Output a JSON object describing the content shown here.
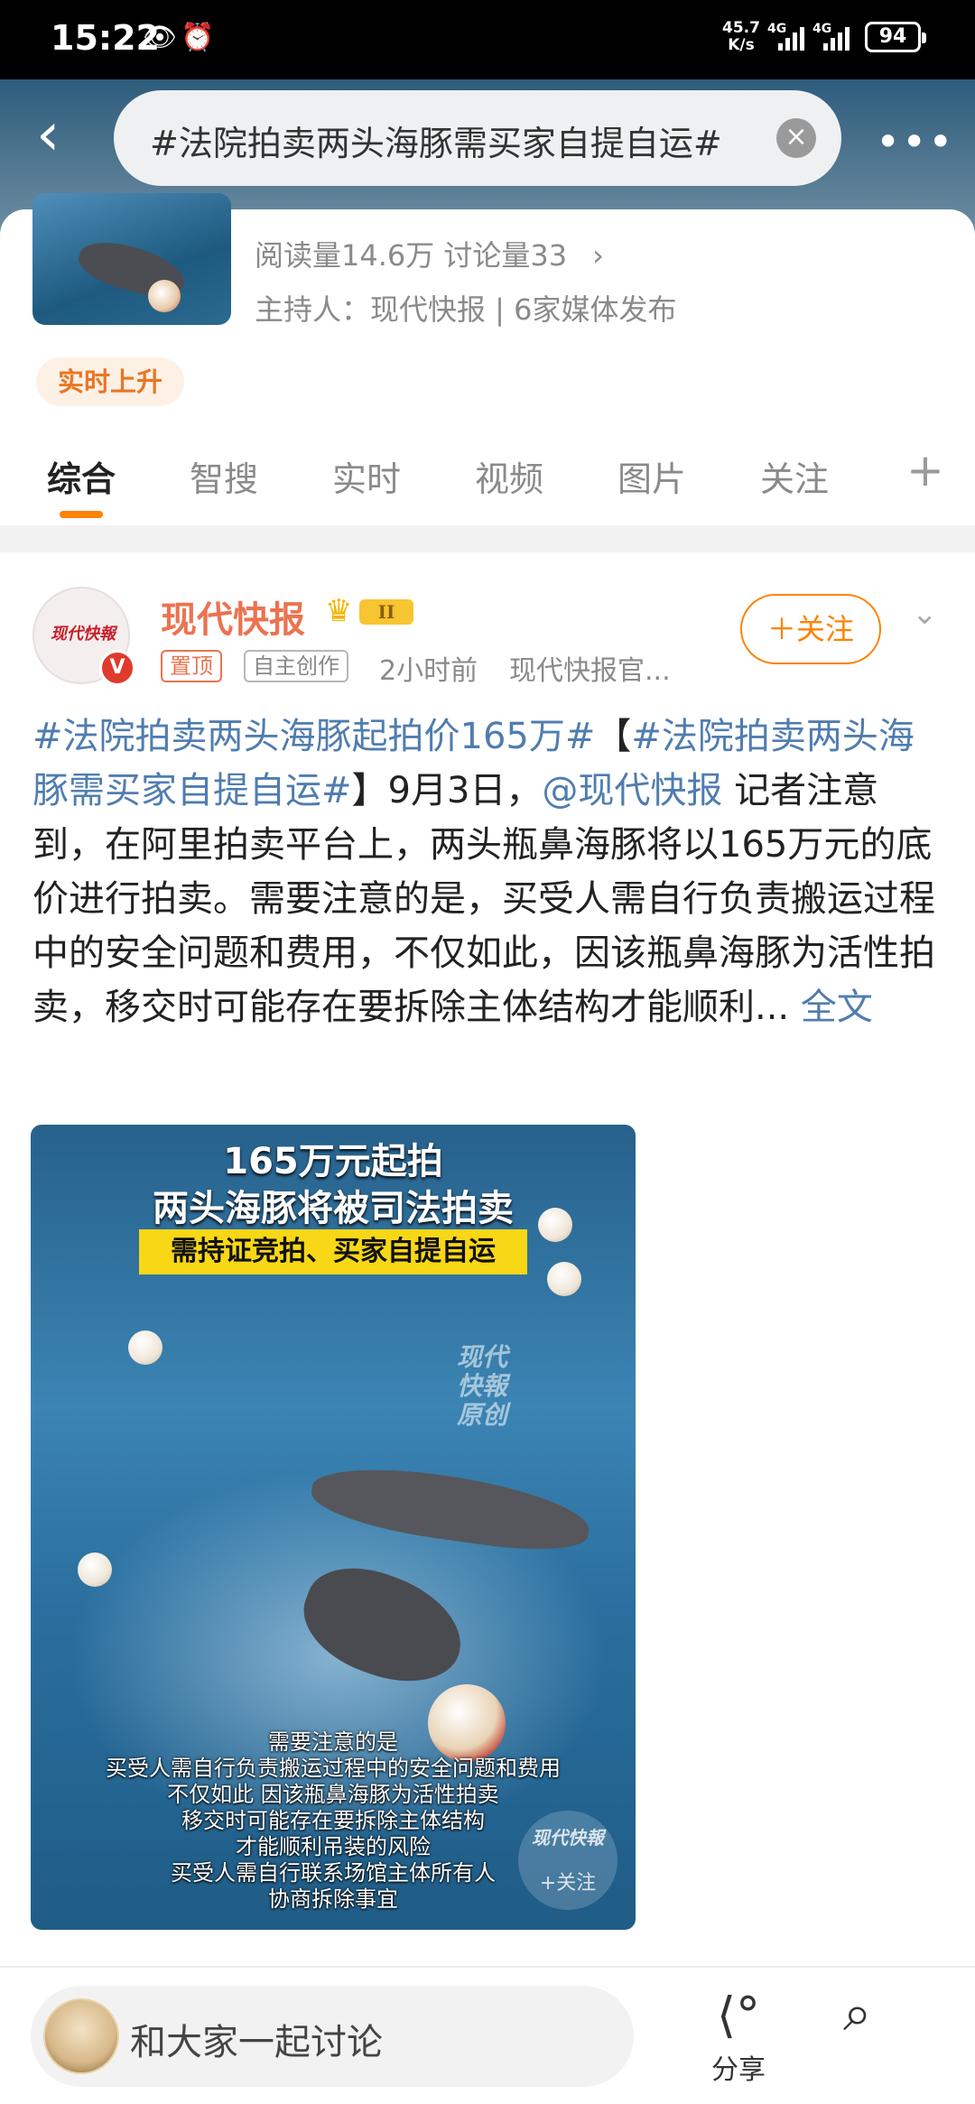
{
  "status_bar": {
    "time": "15:22",
    "net_speed": "45.7\nK/s",
    "sig1": "4G",
    "sig2": "4G",
    "battery": "94"
  },
  "search": {
    "query": "#法院拍卖两头海豚需买家自提自运#"
  },
  "topic": {
    "stats": "阅读量14.6万  讨论量33",
    "host": "主持人：现代快报 | 6家媒体发布",
    "badge": "实时上升"
  },
  "tabs": [
    "综合",
    "智搜",
    "实时",
    "视频",
    "图片",
    "关注"
  ],
  "post": {
    "author": "现代快报",
    "level": "II",
    "tag_pinned": "置顶",
    "tag_original": "自主创作",
    "time": "2小时前",
    "source": "现代快报官...",
    "follow_label": "＋关注",
    "avatar_text": "现代快報",
    "verified": "V",
    "text_parts": {
      "tag1": "#法院拍卖两头海豚起拍价165万#",
      "bracket_open": "【",
      "tag2": "#法院拍卖两头海豚需买家自提自运#",
      "bracket_close": "】",
      "date": "9月3日，",
      "mention": "@现代快报",
      "body": " 记者注意到，在阿里拍卖平台上，两头瓶鼻海豚将以165万元的底价进行拍卖。需要注意的是，买受人需自行负责搬运过程中的安全问题和费用，不仅如此，因该瓶鼻海豚为活性拍卖，移交时可能存在要拆除主体结构才能顺利... ",
      "more": "全文"
    },
    "media": {
      "title1": "165万元起拍",
      "title2": "两头海豚将被司法拍卖",
      "banner": "需持证竞拍、买家自提自运",
      "watermark": "现代\n快報\n原创",
      "caption": "需要注意的是\n买受人需自行负责搬运过程中的安全问题和费用\n不仅如此 因该瓶鼻海豚为活性拍卖\n移交时可能存在要拆除主体结构\n才能顺利吊装的风险\n买受人需自行联系场馆主体所有人\n协商拆除事宜",
      "brand": "现代快報",
      "brand_follow": "+关注"
    }
  },
  "bottom": {
    "discuss_placeholder": "和大家一起讨论",
    "share_label": "分享"
  }
}
